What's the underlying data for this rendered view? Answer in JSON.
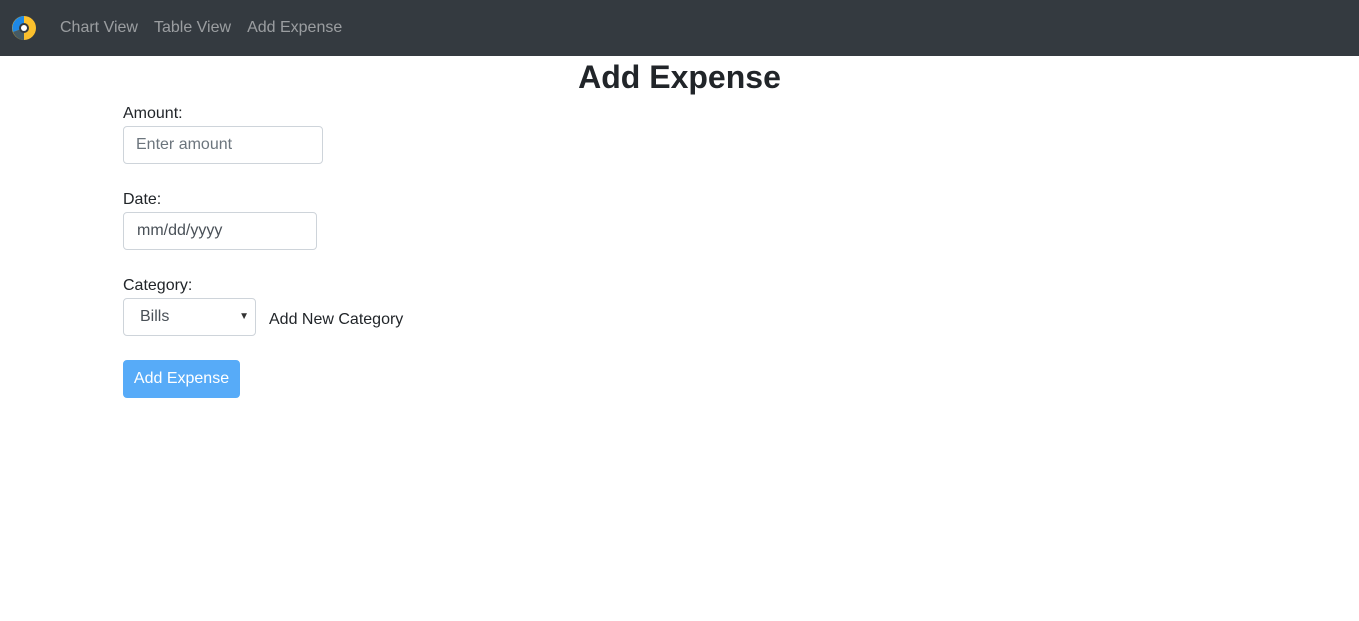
{
  "nav": {
    "logo_icon": "donut-chart-logo-icon",
    "links": [
      "Chart View",
      "Table View",
      "Add Expense"
    ]
  },
  "page": {
    "title": "Add Expense"
  },
  "form": {
    "amount": {
      "label": "Amount:",
      "value": "",
      "placeholder": "Enter amount"
    },
    "date": {
      "label": "Date:",
      "placeholder": "mm/dd/yyyy"
    },
    "category": {
      "label": "Category:",
      "selected": "Bills",
      "arrow_icon": "caret-down-icon",
      "add_new_label": "Add New Category"
    },
    "submit_label": "Add Expense"
  },
  "colors": {
    "navbar_bg": "#343a40",
    "button_bg": "#57abf8",
    "logo_blue": "#1e88e5",
    "logo_yellow": "#fbc02d"
  }
}
